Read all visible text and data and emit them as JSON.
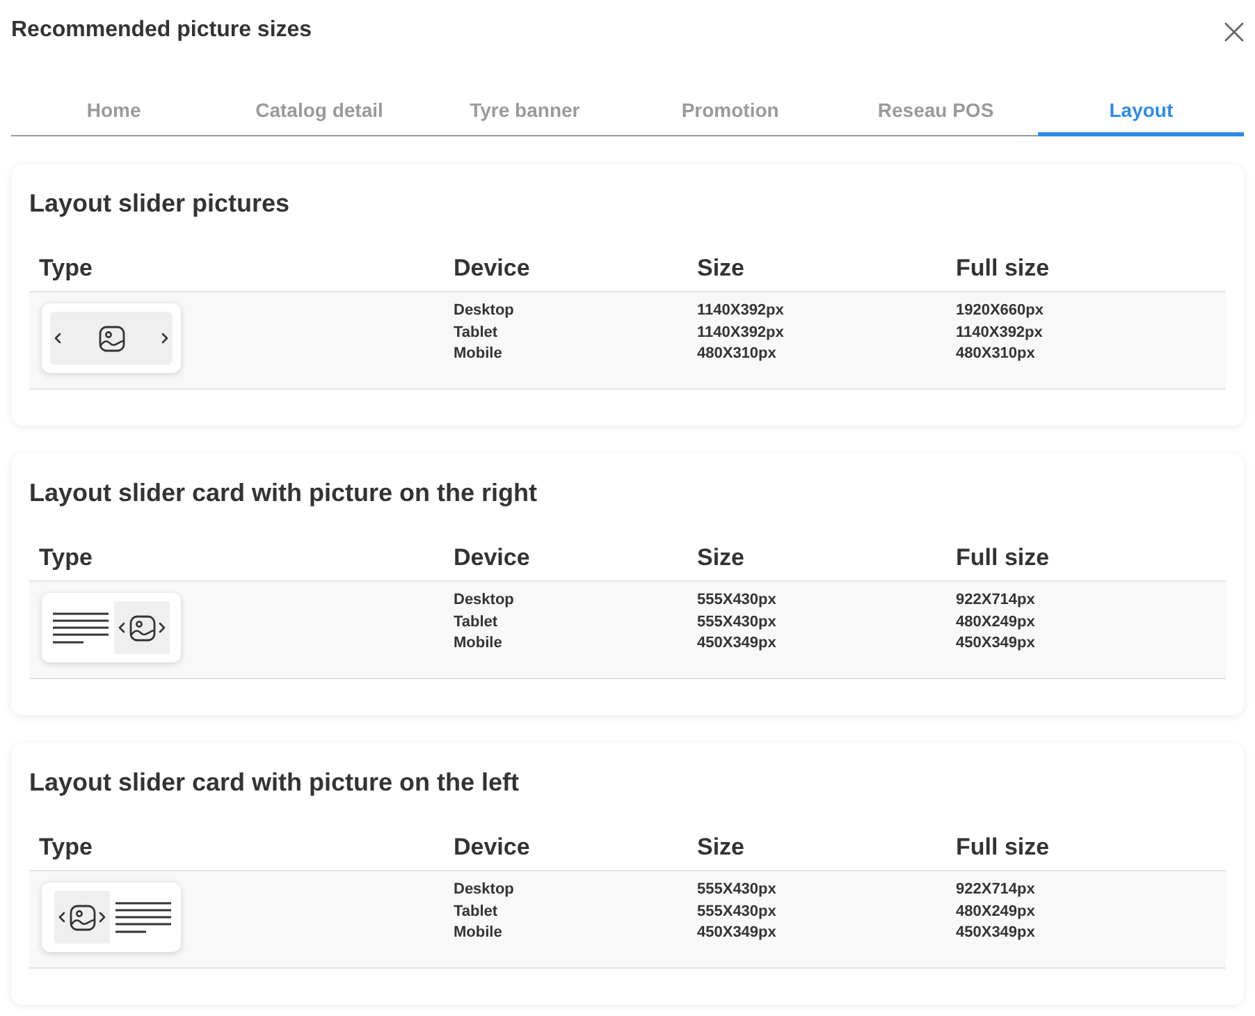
{
  "dialog": {
    "title": "Recommended picture sizes"
  },
  "tabs": [
    {
      "label": "Home",
      "selected": false
    },
    {
      "label": "Catalog detail",
      "selected": false
    },
    {
      "label": "Tyre banner",
      "selected": false
    },
    {
      "label": "Promotion",
      "selected": false
    },
    {
      "label": "Reseau POS",
      "selected": false
    },
    {
      "label": "Layout",
      "selected": true
    }
  ],
  "sections": [
    {
      "heading": "Layout slider pictures",
      "columns": [
        "Type",
        "Device",
        "Size",
        "Full size"
      ],
      "rows": [
        {
          "kind": "slider",
          "entries": [
            {
              "device": "Desktop",
              "size": "1140X392px",
              "full_size": "1920X660px"
            },
            {
              "device": "Tablet",
              "size": "1140X392px",
              "full_size": "1140X392px"
            },
            {
              "device": "Mobile",
              "size": "480X310px",
              "full_size": "480X310px"
            }
          ]
        }
      ]
    },
    {
      "heading": "Layout slider card with picture on the right",
      "columns": [
        "Type",
        "Device",
        "Size",
        "Full size"
      ],
      "rows": [
        {
          "kind": "card_picture_right",
          "entries": [
            {
              "device": "Desktop",
              "size": "555X430px",
              "full_size": "922X714px"
            },
            {
              "device": "Tablet",
              "size": "555X430px",
              "full_size": "480X249px"
            },
            {
              "device": "Mobile",
              "size": "450X349px",
              "full_size": "450X349px"
            }
          ]
        }
      ]
    },
    {
      "heading": "Layout slider card with picture on the left",
      "columns": [
        "Type",
        "Device",
        "Size",
        "Full size"
      ],
      "rows": [
        {
          "kind": "card_picture_left",
          "entries": [
            {
              "device": "Desktop",
              "size": "555X430px",
              "full_size": "922X714px"
            },
            {
              "device": "Tablet",
              "size": "555X430px",
              "full_size": "480X249px"
            },
            {
              "device": "Mobile",
              "size": "450X349px",
              "full_size": "450X349px"
            }
          ]
        }
      ]
    }
  ]
}
